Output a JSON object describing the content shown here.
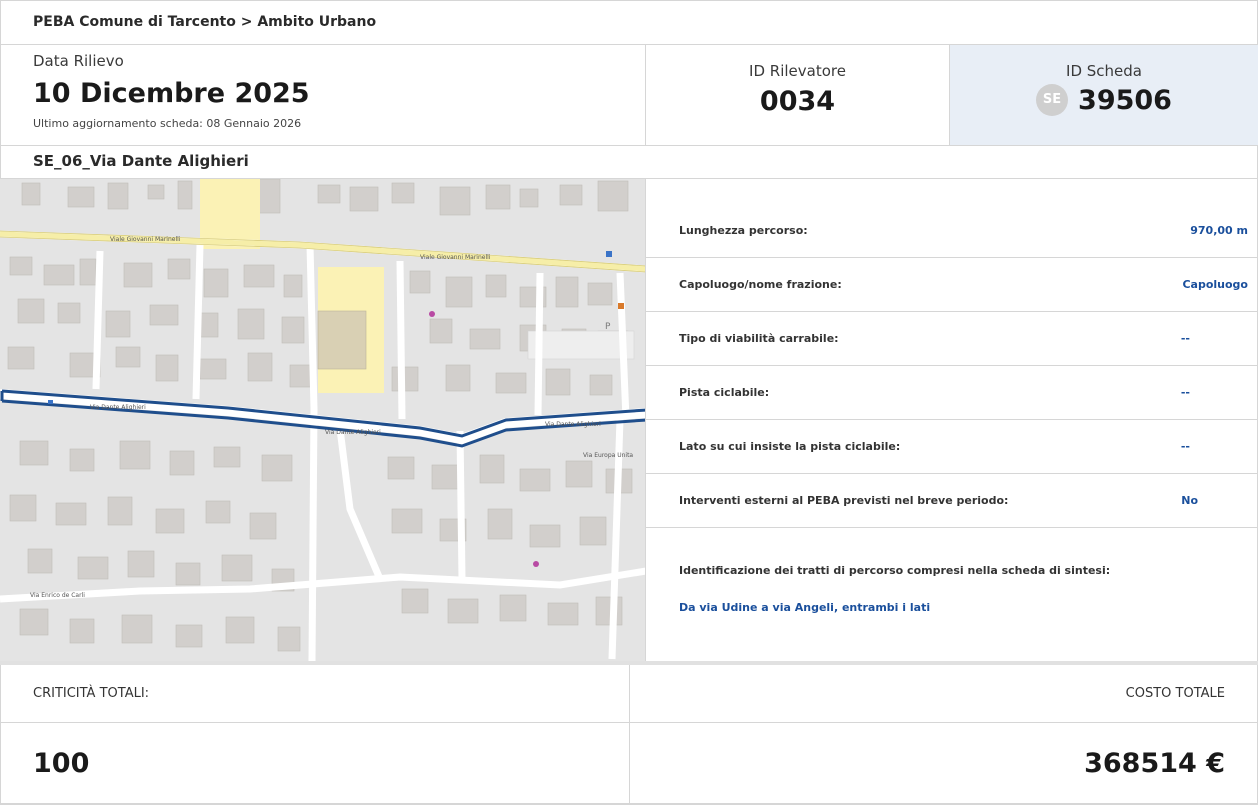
{
  "breadcrumb": "PEBA Comune di Tarcento > Ambito Urbano",
  "survey": {
    "date_label": "Data Rilievo",
    "date_value": "10 Dicembre 2025",
    "last_update": "Ultimo aggiornamento scheda: 08 Gennaio 2026"
  },
  "surveyor": {
    "label": "ID Rilevatore",
    "value": "0034"
  },
  "sheet": {
    "label": "ID Scheda",
    "badge": "SE",
    "value": "39506"
  },
  "street_title": "SE_06_Via Dante Alighieri",
  "map": {
    "road_labels": [
      "Viale Giovanni Marinelli",
      "Viale Giovanni Marinelli",
      "Via Dante Alighieri",
      "Via Dante Alighieri",
      "Via Dante Alighieri",
      "Via Europa Unita",
      "Via Enrico de Carli"
    ],
    "route_color": "#1f4e8c"
  },
  "details": [
    {
      "key": "Lunghezza percorso:",
      "value": "970,00 m"
    },
    {
      "key": "Capoluogo/nome frazione:",
      "value": "Capoluogo"
    },
    {
      "key": "Tipo di viabilità carrabile:",
      "value": "--"
    },
    {
      "key": "Pista ciclabile:",
      "value": "--"
    },
    {
      "key": "Lato su cui insiste la pista ciclabile:",
      "value": "--"
    },
    {
      "key": "Interventi esterni al PEBA previsti nel breve periodo:",
      "value": "No"
    }
  ],
  "identification": {
    "label": "Identificazione dei tratti di percorso compresi nella scheda di sintesi:",
    "value": "Da via Udine a via Angeli, entrambi i lati"
  },
  "totals": {
    "criticita_label": "CRITICITÀ TOTALI:",
    "criticita_value": "100",
    "costo_label": "COSTO TOTALE",
    "costo_value": "368514 €"
  },
  "colors": {
    "accent": "#1a4f9c",
    "header_highlight": "#e8eef6",
    "route": "#1f4e8c"
  }
}
